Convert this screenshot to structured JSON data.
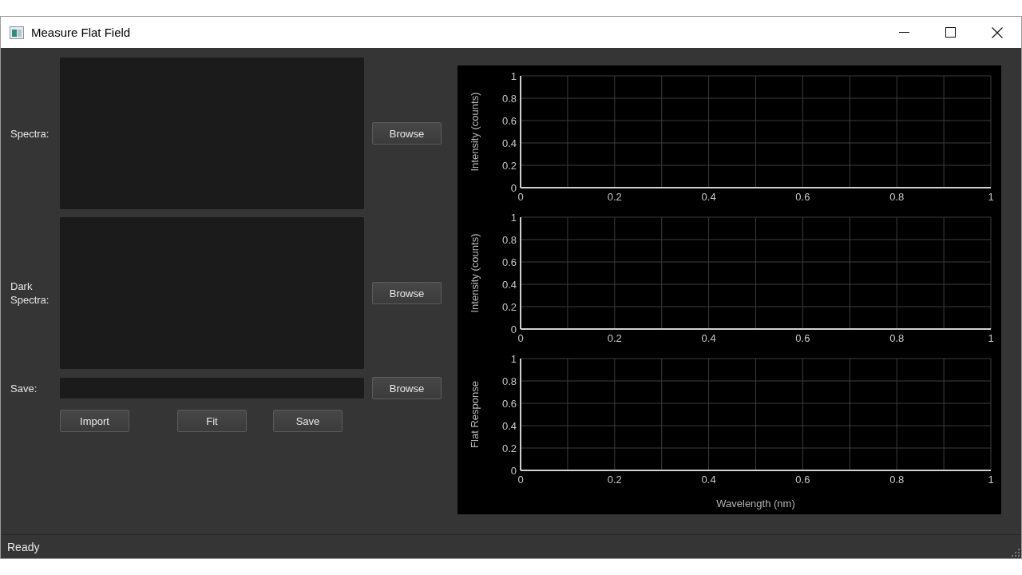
{
  "window": {
    "title": "Measure Flat Field"
  },
  "form": {
    "rows": [
      {
        "kind": "list",
        "label": "Spectra:",
        "button": "Browse"
      },
      {
        "kind": "list",
        "label": "Dark Spectra:",
        "button": "Browse"
      },
      {
        "kind": "field",
        "label": "Save:",
        "button": "Browse"
      }
    ],
    "actions": [
      "Import",
      "Fit",
      "Save"
    ]
  },
  "charts": [
    {
      "chart_data": {
        "type": "line",
        "ylabel": "Intensity (counts)",
        "xlim": [
          0,
          1
        ],
        "ylim": [
          0,
          1
        ],
        "xticks": [
          0,
          0.2,
          0.4,
          0.6,
          0.8,
          1
        ],
        "yticks": [
          0,
          0.2,
          0.4,
          0.6,
          0.8,
          1
        ],
        "grid": true
      }
    },
    {
      "chart_data": {
        "type": "line",
        "ylabel": "Intensity (counts)",
        "xlim": [
          0,
          1
        ],
        "ylim": [
          0,
          1
        ],
        "xticks": [
          0,
          0.2,
          0.4,
          0.6,
          0.8,
          1
        ],
        "yticks": [
          0,
          0.2,
          0.4,
          0.6,
          0.8,
          1
        ],
        "grid": true
      }
    },
    {
      "chart_data": {
        "type": "line",
        "ylabel": "Flat Response",
        "xlabel": "Wavelength (nm)",
        "xlim": [
          0,
          1
        ],
        "ylim": [
          0,
          1
        ],
        "xticks": [
          0,
          0.2,
          0.4,
          0.6,
          0.8,
          1
        ],
        "yticks": [
          0,
          0.2,
          0.4,
          0.6,
          0.8,
          1
        ],
        "grid": true
      }
    }
  ],
  "status_bar": {
    "text": "Ready"
  }
}
